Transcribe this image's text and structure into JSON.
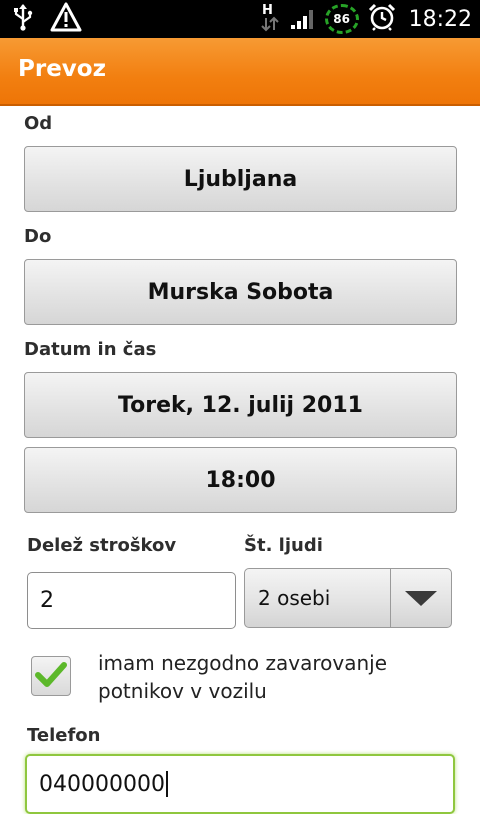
{
  "status_bar": {
    "time": "18:22",
    "battery": "86",
    "network": "H",
    "icons": [
      "usb-icon",
      "warning-icon",
      "network-h-icon",
      "signal-icon",
      "battery-icon",
      "alarm-icon"
    ]
  },
  "app": {
    "title": "Prevoz"
  },
  "form": {
    "from_label": "Od",
    "from_value": "Ljubljana",
    "to_label": "Do",
    "to_value": "Murska Sobota",
    "datetime_label": "Datum in čas",
    "date_value": "Torek, 12. julij 2011",
    "time_value": "18:00",
    "cost_label": "Delež stroškov",
    "cost_value": "2",
    "people_label": "Št. ljudi",
    "people_value": "2 osebi",
    "insurance_checked": true,
    "insurance_label": "imam nezgodno zavarovanje potnikov v vozilu",
    "phone_label": "Telefon",
    "phone_value": "040000000"
  },
  "colors": {
    "accent": "#f27f10",
    "check_green": "#5cb82a",
    "focus_green": "#8fc73e"
  }
}
